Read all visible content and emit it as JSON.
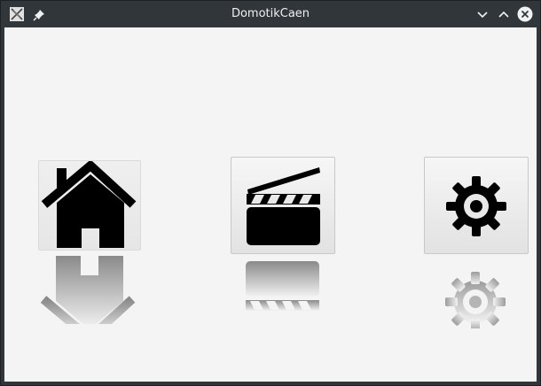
{
  "window": {
    "title": "DomotikCaen"
  },
  "titlebar": {
    "app_icon": "application-icon",
    "pin_icon": "pin-icon",
    "buttons": [
      "minimize-icon",
      "maximize-icon",
      "close-icon"
    ]
  },
  "tiles": [
    {
      "icon": "house-icon"
    },
    {
      "icon": "clapperboard-icon"
    },
    {
      "icon": "gear-icon"
    }
  ],
  "colors": {
    "titlebar": "#31363b",
    "content_background": "#f4f4f4",
    "icon": "#000000",
    "close_button": "#eff0f1"
  }
}
